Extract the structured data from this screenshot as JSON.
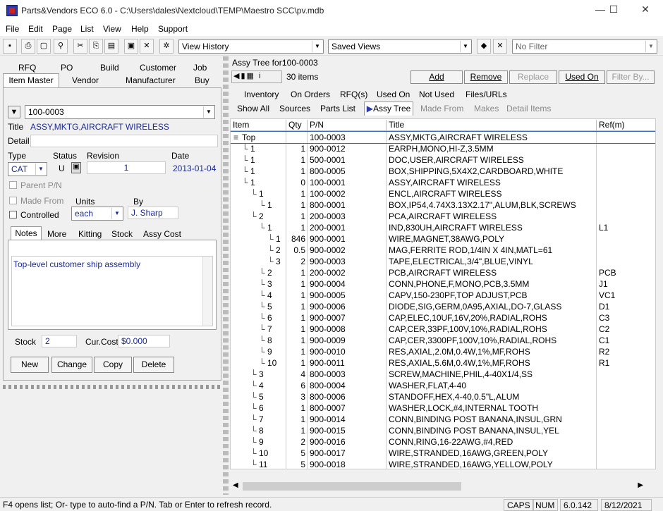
{
  "window": {
    "title": "Parts&Vendors ECO 6.0 - C:\\Users\\dales\\Nextcloud\\TEMP\\Maestro SCC\\pv.mdb",
    "minimize": "—",
    "maximize": "☐",
    "close": "✕"
  },
  "menu": [
    "File",
    "Edit",
    "Page",
    "List",
    "View",
    "Help",
    "Support"
  ],
  "toolbar": {
    "view_history": "View History",
    "saved_views": "Saved Views",
    "filter": "No Filter",
    "icons": [
      "save-icon",
      "print-icon",
      "preview-icon",
      "find-icon",
      "cut-icon",
      "copy-icon",
      "paste-icon",
      "window-icon",
      "close-icon",
      "settings-icon"
    ]
  },
  "left": {
    "tabs_row1": [
      "RFQ",
      "PO",
      "Build",
      "Customer",
      "Job"
    ],
    "tabs_row2": [
      "Item Master",
      "Vendor",
      "Manufacturer",
      "Buy"
    ],
    "item_number": "100-0003",
    "title_label": "Title",
    "title_value": "ASSY,MKTG,AIRCRAFT WIRELESS",
    "detail_label": "Detail",
    "type_label": "Type",
    "status_label": "Status",
    "revision_label": "Revision",
    "date_label": "Date",
    "type_value": "CAT",
    "status_value": "U",
    "revision_value": "1",
    "date_value": "2013-01-04",
    "parent_pn": "Parent P/N",
    "made_from": "Made From",
    "units_label": "Units",
    "by_label": "By",
    "controlled": "Controlled",
    "units_value": "each",
    "by_value": "J. Sharp",
    "sub_tabs": [
      "Notes",
      "More",
      "Kitting",
      "Stock",
      "Assy Cost"
    ],
    "notes": "Top-level customer ship assembly",
    "stock_label": "Stock",
    "stock_value": "2",
    "cost_label": "Cur.Cost",
    "cost_value": "$0.000",
    "buttons": [
      "New",
      "Change",
      "Copy",
      "Delete"
    ]
  },
  "right": {
    "assy_tree_for_label": "Assy Tree for:",
    "assy_tree_for_value": "100-0003",
    "item_count": "30 items",
    "actions": [
      "Add",
      "Remove",
      "Replace",
      "Used On",
      "Filter By..."
    ],
    "tabs_row1": [
      "Inventory",
      "On Orders",
      "RFQ(s)",
      "Used On",
      "Not Used",
      "Files/URLs"
    ],
    "tabs_row2": [
      "Show All",
      "Sources",
      "Parts List",
      "Assy Tree",
      "Made From",
      "Makes",
      "Detail Items"
    ],
    "columns": [
      "Item",
      "Qty",
      "P/N",
      "Title",
      "Ref(m)"
    ],
    "rows": [
      {
        "item": "Top",
        "qty": "",
        "pn": "100-0003",
        "title": "ASSY,MKTG,AIRCRAFT WIRELESS",
        "ref": "",
        "lvl": 0
      },
      {
        "item": "1",
        "qty": "1",
        "pn": "900-0012",
        "title": "EARPH,MONO,HI-Z,3.5MM",
        "ref": "",
        "lvl": 1
      },
      {
        "item": "1",
        "qty": "1",
        "pn": "500-0001",
        "title": "DOC,USER,AIRCRAFT WIRELESS",
        "ref": "",
        "lvl": 1
      },
      {
        "item": "1",
        "qty": "1",
        "pn": "800-0005",
        "title": "BOX,SHIPPING,5X4X2,CARDBOARD,WHITE",
        "ref": "",
        "lvl": 1
      },
      {
        "item": "1",
        "qty": "0",
        "pn": "100-0001",
        "title": "ASSY,AIRCRAFT WIRELESS",
        "ref": "",
        "lvl": 1
      },
      {
        "item": "1",
        "qty": "1",
        "pn": "100-0002",
        "title": "ENCL,AIRCRAFT WIRELESS",
        "ref": "",
        "lvl": 2
      },
      {
        "item": "1",
        "qty": "1",
        "pn": "800-0001",
        "title": "BOX,IP54,4.74X3.13X2.17\",ALUM,BLK,SCREWS",
        "ref": "",
        "lvl": 3
      },
      {
        "item": "2",
        "qty": "1",
        "pn": "200-0003",
        "title": "PCA,AIRCRAFT WIRELESS",
        "ref": "",
        "lvl": 2
      },
      {
        "item": "1",
        "qty": "1",
        "pn": "200-0001",
        "title": "IND,830UH,AIRCRAFT WIRELESS",
        "ref": "L1",
        "lvl": 3
      },
      {
        "item": "1",
        "qty": "846",
        "pn": "900-0001",
        "title": "WIRE,MAGNET,38AWG,POLY",
        "ref": "",
        "lvl": 4
      },
      {
        "item": "2",
        "qty": "0.5",
        "pn": "900-0002",
        "title": "MAG,FERRITE ROD,1/4IN X 4IN,MATL=61",
        "ref": "",
        "lvl": 4
      },
      {
        "item": "3",
        "qty": "2",
        "pn": "900-0003",
        "title": "TAPE,ELECTRICAL,3/4\",BLUE,VINYL",
        "ref": "",
        "lvl": 4
      },
      {
        "item": "2",
        "qty": "1",
        "pn": "200-0002",
        "title": "PCB,AIRCRAFT WIRELESS",
        "ref": "PCB",
        "lvl": 3
      },
      {
        "item": "3",
        "qty": "1",
        "pn": "900-0004",
        "title": "CONN,PHONE,F,MONO,PCB,3.5MM",
        "ref": "J1",
        "lvl": 3
      },
      {
        "item": "4",
        "qty": "1",
        "pn": "900-0005",
        "title": "CAPV,150-230PF,TOP ADJUST,PCB",
        "ref": "VC1",
        "lvl": 3
      },
      {
        "item": "5",
        "qty": "1",
        "pn": "900-0006",
        "title": "DIODE,SIG,GERM,0A95,AXIAL,DO-7,GLASS",
        "ref": "D1",
        "lvl": 3
      },
      {
        "item": "6",
        "qty": "1",
        "pn": "900-0007",
        "title": "CAP,ELEC,10UF,16V,20%,RADIAL,ROHS",
        "ref": "C3",
        "lvl": 3
      },
      {
        "item": "7",
        "qty": "1",
        "pn": "900-0008",
        "title": "CAP,CER,33PF,100V,10%,RADIAL,ROHS",
        "ref": "C2",
        "lvl": 3
      },
      {
        "item": "8",
        "qty": "1",
        "pn": "900-0009",
        "title": "CAP,CER,3300PF,100V,10%,RADIAL,ROHS",
        "ref": "C1",
        "lvl": 3
      },
      {
        "item": "9",
        "qty": "1",
        "pn": "900-0010",
        "title": "RES,AXIAL,2.0M,0.4W,1%,MF,ROHS",
        "ref": "R2",
        "lvl": 3
      },
      {
        "item": "10",
        "qty": "1",
        "pn": "900-0011",
        "title": "RES,AXIAL,5.6M,0.4W,1%,MF,ROHS",
        "ref": "R1",
        "lvl": 3
      },
      {
        "item": "3",
        "qty": "4",
        "pn": "800-0003",
        "title": "SCREW,MACHINE,PHIL,4-40X1/4,SS",
        "ref": "",
        "lvl": 2
      },
      {
        "item": "4",
        "qty": "6",
        "pn": "800-0004",
        "title": "WASHER,FLAT,4-40",
        "ref": "",
        "lvl": 2
      },
      {
        "item": "5",
        "qty": "3",
        "pn": "800-0006",
        "title": "STANDOFF,HEX,4-40,0.5\"L,ALUM",
        "ref": "",
        "lvl": 2
      },
      {
        "item": "6",
        "qty": "1",
        "pn": "800-0007",
        "title": "WASHER,LOCK,#4,INTERNAL TOOTH",
        "ref": "",
        "lvl": 2
      },
      {
        "item": "7",
        "qty": "1",
        "pn": "900-0014",
        "title": "CONN,BINDING POST BANANA,INSUL,GRN",
        "ref": "",
        "lvl": 2
      },
      {
        "item": "8",
        "qty": "1",
        "pn": "900-0015",
        "title": "CONN,BINDING POST BANANA,INSUL,YEL",
        "ref": "",
        "lvl": 2
      },
      {
        "item": "9",
        "qty": "2",
        "pn": "900-0016",
        "title": "CONN,RING,16-22AWG,#4,RED",
        "ref": "",
        "lvl": 2
      },
      {
        "item": "10",
        "qty": "5",
        "pn": "900-0017",
        "title": "WIRE,STRANDED,16AWG,GREEN,POLY",
        "ref": "",
        "lvl": 2
      },
      {
        "item": "11",
        "qty": "5",
        "pn": "900-0018",
        "title": "WIRE,STRANDED,16AWG,YELLOW,POLY",
        "ref": "",
        "lvl": 2
      }
    ]
  },
  "status": {
    "hint": "F4 opens list; Or- type to auto-find a P/N.  Tab or Enter to refresh record.",
    "caps": "CAPS",
    "num": "NUM",
    "version": "6.0.142",
    "date": "8/12/2021"
  }
}
